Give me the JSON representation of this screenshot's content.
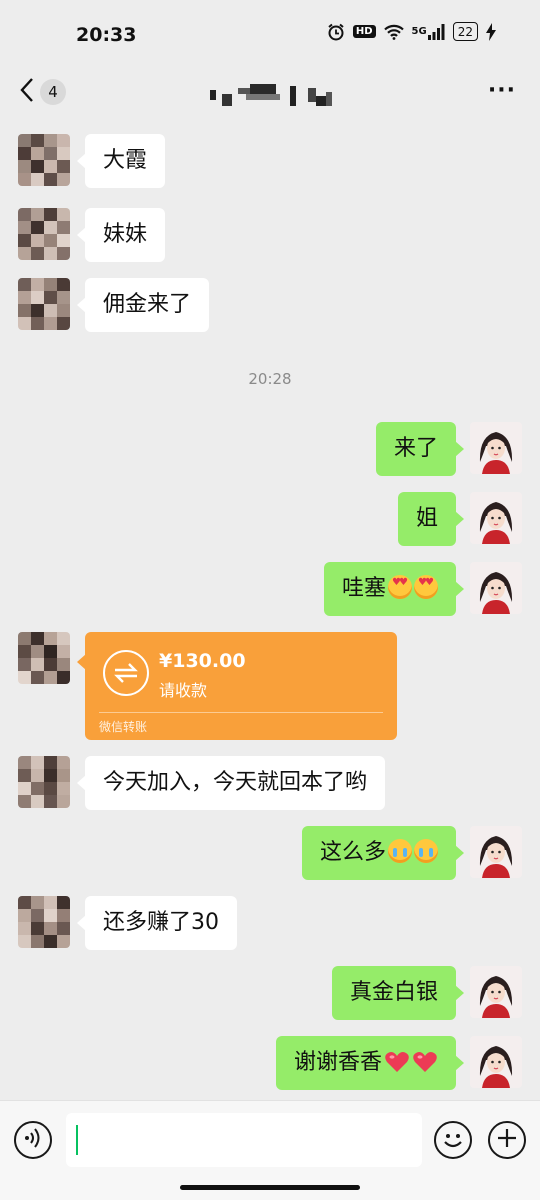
{
  "status_bar": {
    "time": "20:33",
    "hd": "HD",
    "network": "5G",
    "battery": "22",
    "icons": [
      "alarm-icon",
      "hd-icon",
      "wifi-icon",
      "signal-5g-icon",
      "battery-icon",
      "charging-icon"
    ]
  },
  "header": {
    "unread_count": "4",
    "title_icon": "pixelated-name",
    "more": "···"
  },
  "chat": {
    "timestamp": "20:28",
    "messages": [
      {
        "side": "left",
        "text": "大霞"
      },
      {
        "side": "left",
        "text": "妹妹"
      },
      {
        "side": "left",
        "text": "佣金来了"
      },
      {
        "side": "right",
        "text": "来了"
      },
      {
        "side": "right",
        "text": "姐"
      },
      {
        "side": "right",
        "text": "哇塞",
        "emoji": [
          "heart-eyes-emoji",
          "heart-eyes-emoji"
        ]
      },
      {
        "side": "left",
        "type": "transfer"
      },
      {
        "side": "left",
        "text": "今天加入，今天就回本了哟"
      },
      {
        "side": "right",
        "text": "这么多",
        "emoji": [
          "crying-emoji",
          "crying-emoji"
        ]
      },
      {
        "side": "left",
        "text": "还多赚了30"
      },
      {
        "side": "right",
        "text": "真金白银"
      },
      {
        "side": "right",
        "text": "谢谢香香",
        "emoji": [
          "red-heart-emoji",
          "red-heart-emoji"
        ]
      }
    ],
    "transfer": {
      "amount": "¥130.00",
      "note": "请收款",
      "footer": "微信转账",
      "color": "#f9a03a"
    }
  },
  "colors": {
    "background": "#ededed",
    "bubble_out": "#95ec69",
    "bubble_in": "#ffffff",
    "accent": "#07c160"
  }
}
